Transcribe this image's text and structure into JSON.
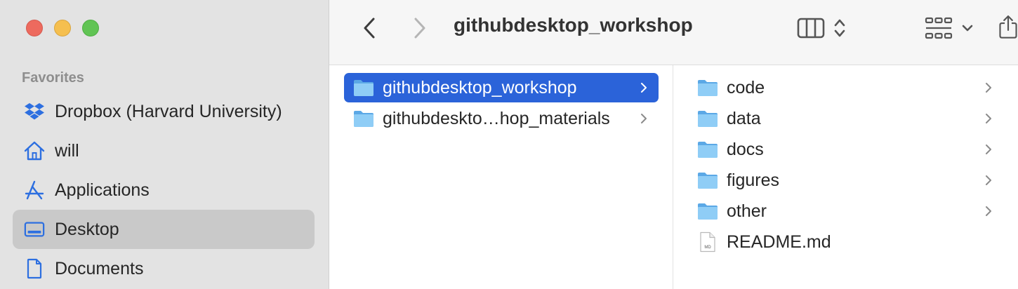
{
  "window": {
    "title": "githubdesktop_workshop"
  },
  "sidebar": {
    "section_label": "Favorites",
    "items": [
      {
        "label": "Dropbox (Harvard University)",
        "icon": "dropbox-icon"
      },
      {
        "label": "will",
        "icon": "home-icon"
      },
      {
        "label": "Applications",
        "icon": "applications-icon"
      },
      {
        "label": "Desktop",
        "icon": "desktop-icon",
        "selected": true
      },
      {
        "label": "Documents",
        "icon": "document-icon"
      }
    ]
  },
  "column1": {
    "items": [
      {
        "label": "githubdesktop_workshop",
        "type": "folder",
        "selected": true
      },
      {
        "label": "githubdeskto…hop_materials",
        "type": "folder"
      }
    ]
  },
  "column2": {
    "items": [
      {
        "label": "code",
        "type": "folder"
      },
      {
        "label": "data",
        "type": "folder"
      },
      {
        "label": "docs",
        "type": "folder"
      },
      {
        "label": "figures",
        "type": "folder"
      },
      {
        "label": "other",
        "type": "folder"
      },
      {
        "label": "README.md",
        "type": "file",
        "badge": "MD"
      }
    ]
  },
  "colors": {
    "accent": "#2b63d9",
    "sidebar_icon": "#2d6fe0",
    "folder": "#6fb6ec"
  }
}
